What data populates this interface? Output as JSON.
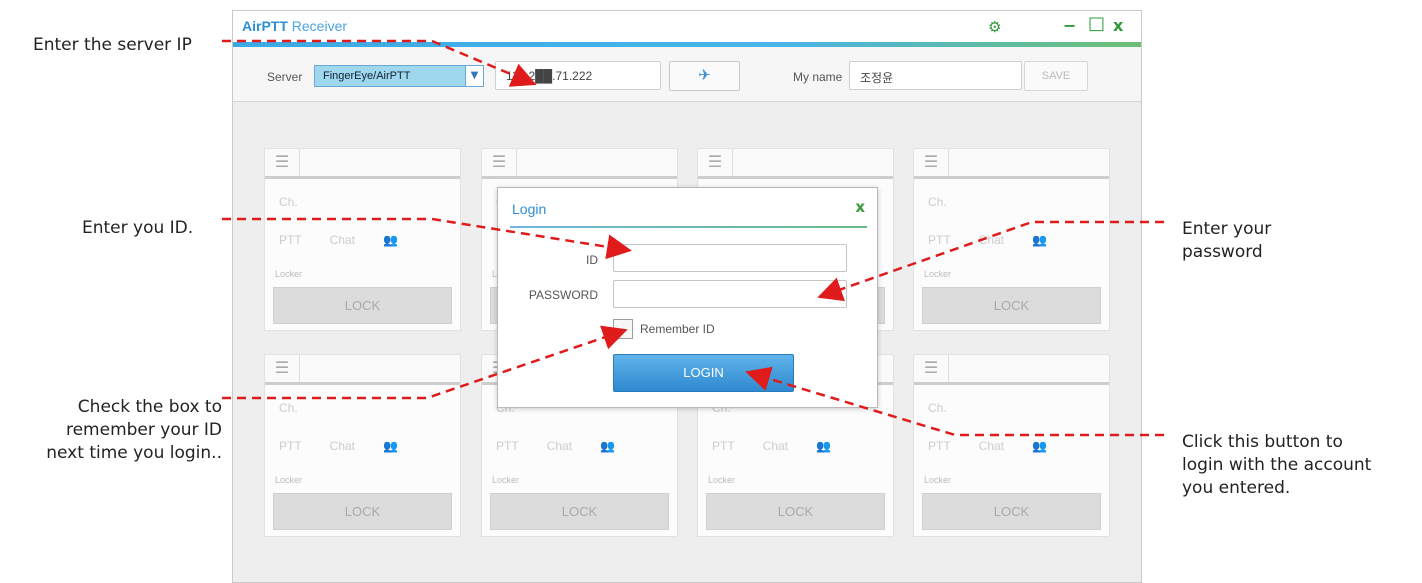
{
  "annotations": {
    "server_ip": "Enter the server IP",
    "enter_id": "Enter you ID.",
    "password": "Enter your\npassword",
    "remember": "Check the box to\nremember your ID\nnext time you login..",
    "login": "Click this button to\nlogin with the account\nyou entered."
  },
  "app": {
    "title_brand": "AirPTT",
    "title_rest": " Receiver",
    "controls": {
      "settings": "⚙",
      "minimize": "−",
      "maximize": "□",
      "close": "x"
    }
  },
  "toolbar": {
    "server_label": "Server",
    "server_value": "FingerEye/AirPTT",
    "ip_value": "112.2██.71.222",
    "my_name_label": "My name",
    "my_name_value": "조정윤",
    "save_label": "SAVE"
  },
  "cards": {
    "ch_label": "Ch.",
    "ptt_label": "PTT",
    "chat_label": "Chat",
    "locker_label": "Locker",
    "lock_label": "LOCK"
  },
  "login_dialog": {
    "title": "Login",
    "close": "x",
    "id_label": "ID",
    "password_label": "PASSWORD",
    "remember_label": "Remember ID",
    "login_button": "LOGIN"
  },
  "colors": {
    "accent_blue": "#2e8fd4",
    "arrow_red": "#e01b1b",
    "login_button": "#3a93d6"
  }
}
